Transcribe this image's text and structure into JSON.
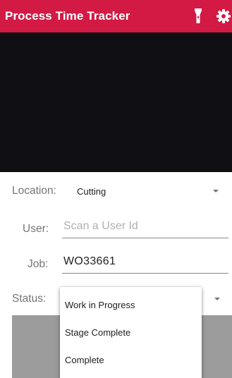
{
  "appbar": {
    "title": "Process Time Tracker",
    "background": "#d21a45",
    "flashlight_icon": "flashlight-icon",
    "settings_icon": "gear-icon"
  },
  "form": {
    "location": {
      "label": "Location:",
      "value": "Cutting"
    },
    "user": {
      "label": "User:",
      "value": "",
      "placeholder": "Scan a User Id"
    },
    "job": {
      "label": "Job:",
      "value": "WO33661"
    },
    "status": {
      "label": "Status:",
      "options": [
        "Work in Progress",
        "Stage Complete",
        "Complete"
      ]
    }
  }
}
